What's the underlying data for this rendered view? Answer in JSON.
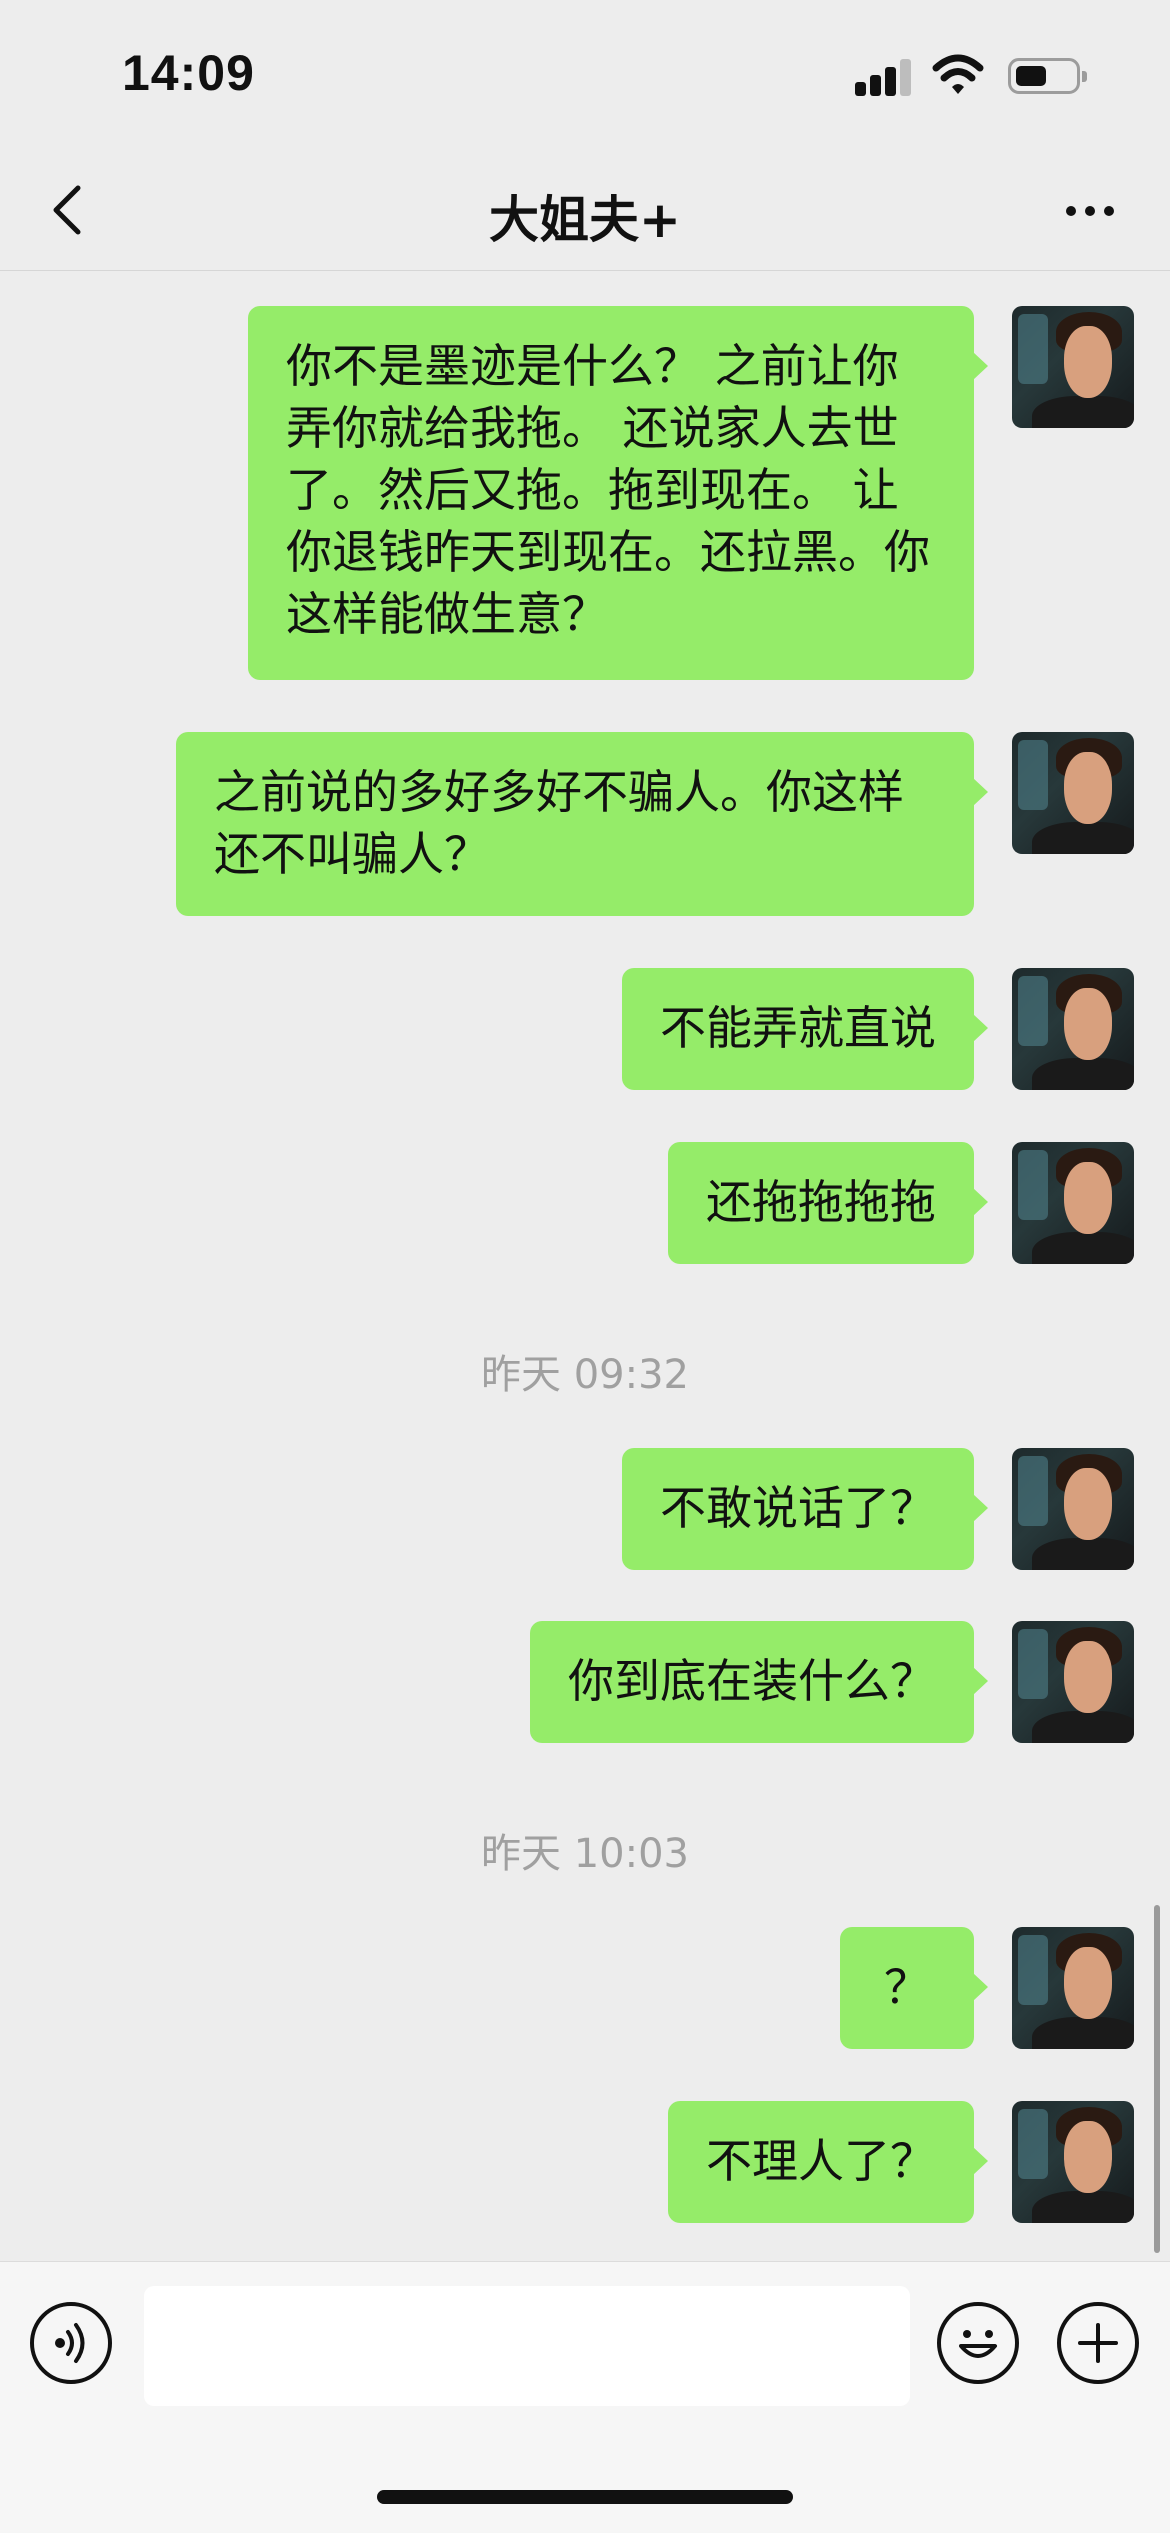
{
  "status_bar": {
    "time": "14:09"
  },
  "header": {
    "title": "大姐夫+"
  },
  "messages": [
    {
      "text": "你不是墨迹是什么？   之前让你弄你就给我拖。 还说家人去世了。然后又拖。拖到现在。 让你退钱昨天到现在。还拉黑。你这样能做生意？"
    },
    {
      "text": "之前说的多好多好不骗人。你这样还不叫骗人？"
    },
    {
      "text": "不能弄就直说"
    },
    {
      "text": "还拖拖拖拖"
    },
    {
      "text": "不敢说话了？"
    },
    {
      "text": "你到底在装什么？"
    },
    {
      "text": "？"
    },
    {
      "text": "不理人了？"
    }
  ],
  "timestamps": [
    "昨天 09:32",
    "昨天 10:03"
  ],
  "icons": {
    "back": "chevron-left-icon",
    "more": "more-dots-icon",
    "voice": "voice-icon",
    "emoji": "emoji-icon",
    "plus": "plus-icon"
  },
  "colors": {
    "bubble": "#95ec69",
    "background": "#ededed"
  }
}
